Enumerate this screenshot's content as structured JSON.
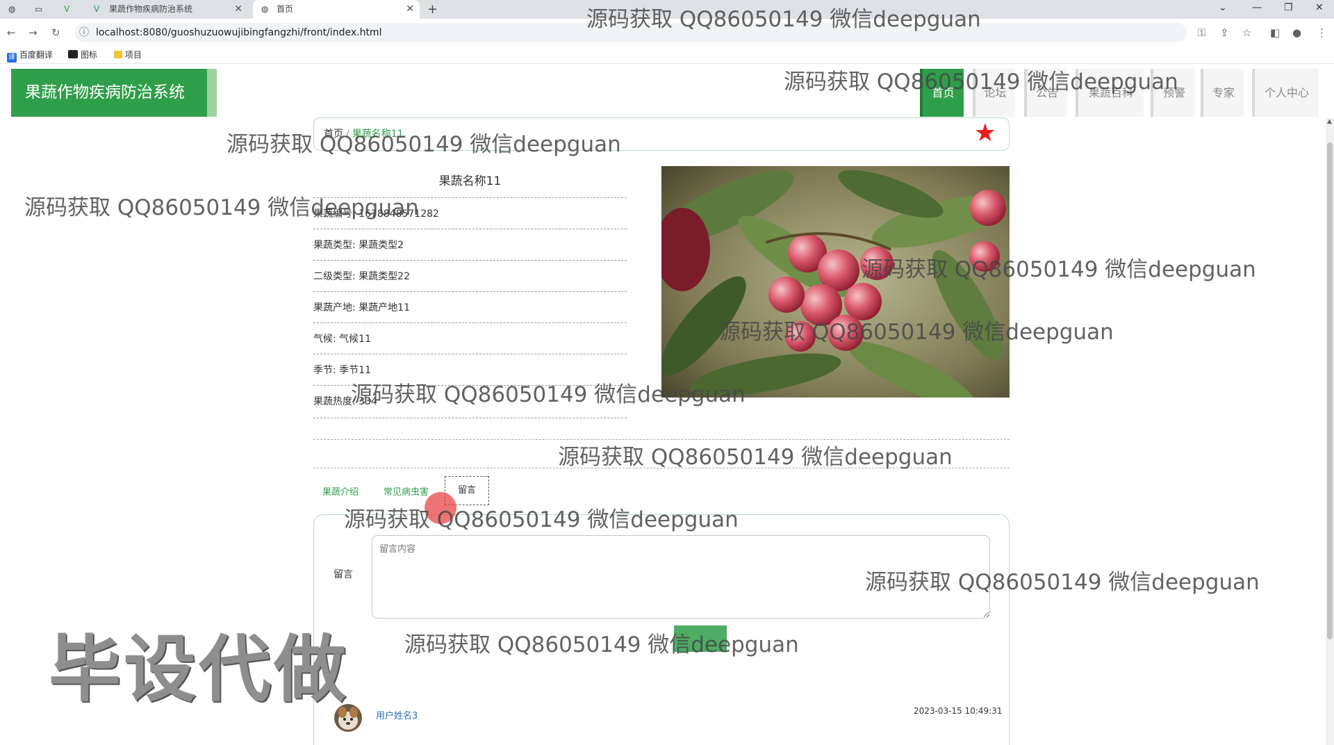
{
  "browser": {
    "tabs": [
      {
        "title": "果蔬作物疾病防治系统"
      },
      {
        "title": "首页"
      }
    ],
    "new_tab_symbol": "+",
    "url": "localhost:8080/guoshuzuowujibingfangzhi/front/index.html",
    "bookmarks": [
      "百度翻译",
      "图标",
      "项目"
    ]
  },
  "header": {
    "logo": "果蔬作物疾病防治系统",
    "nav": [
      "首页",
      "论坛",
      "公告",
      "果蔬百科",
      "预警",
      "专家",
      "个人中心"
    ],
    "active_nav": "首页"
  },
  "breadcrumb": {
    "home": "首页",
    "separator": "/",
    "current": "果蔬名称11"
  },
  "product": {
    "title": "果蔬名称11",
    "fields": [
      "果蔬编号: 1678848571282",
      "果蔬类型: 果蔬类型2",
      "二级类型: 果蔬类型22",
      "果蔬产地: 果蔬产地11",
      "气候: 气候11",
      "季节: 季节11",
      "果蔬热度: 334"
    ]
  },
  "detail_tabs": [
    "果蔬介绍",
    "常见病虫害",
    "留言"
  ],
  "active_detail_tab": "留言",
  "comment_form": {
    "label": "留言",
    "placeholder": "留言内容"
  },
  "comments": [
    {
      "user": "用户姓名3",
      "time": "2023-03-15 10:49:31"
    }
  ],
  "watermarks": [
    "源码获取 QQ86050149 微信deepguan",
    "毕设代做"
  ],
  "colors": {
    "brand_green": "#2f9e4a",
    "star_red": "#ee1c1c",
    "link_blue": "#2f6fb3"
  }
}
